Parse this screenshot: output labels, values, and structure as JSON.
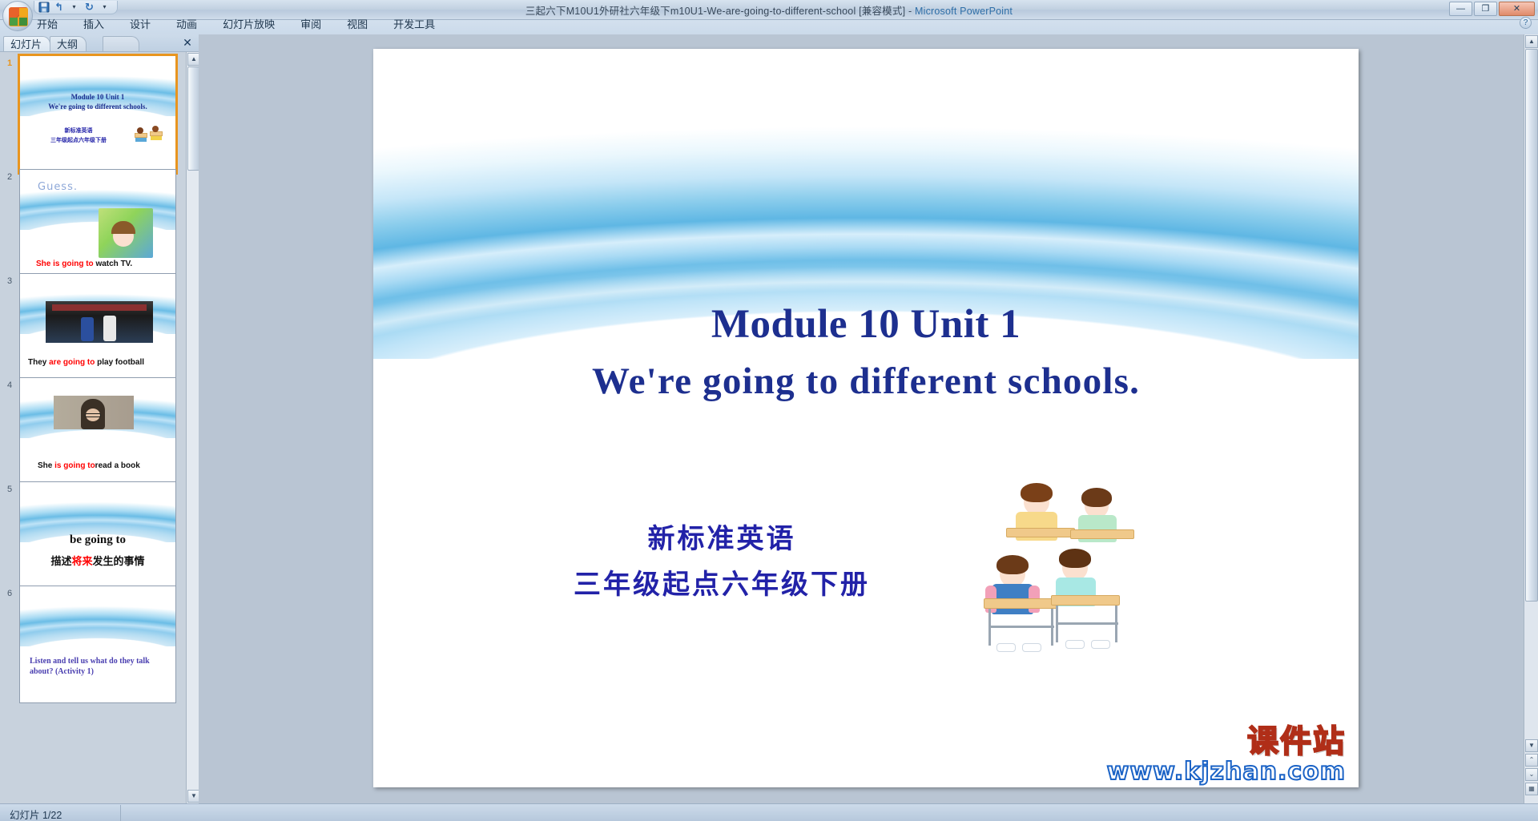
{
  "window": {
    "title": "三起六下M10U1外研社六年级下m10U1-We-are-going-to-different-school [兼容模式]",
    "separator": "-",
    "app_name": "Microsoft PowerPoint",
    "minimize": "—",
    "maximize": "❐",
    "close": "✕",
    "help_icon": "?"
  },
  "quick_access": {
    "save_icon": "save-icon",
    "undo_icon": "undo-icon",
    "undo_arrow": "↰",
    "undo_dropdown": "▾",
    "redo_arrow": "↻",
    "customize": "▾"
  },
  "ribbon_tabs": [
    {
      "label": "开始"
    },
    {
      "label": "插入"
    },
    {
      "label": "设计"
    },
    {
      "label": "动画"
    },
    {
      "label": "幻灯片放映"
    },
    {
      "label": "审阅"
    },
    {
      "label": "视图"
    },
    {
      "label": "开发工具"
    }
  ],
  "left_pane": {
    "tabs": [
      {
        "label": "幻灯片"
      },
      {
        "label": "大纲"
      }
    ],
    "close_label": "✕",
    "slides": [
      {
        "number": "1",
        "selected": true,
        "lines": [
          {
            "text": "Module 10 Unit 1"
          },
          {
            "text": "We're going to different schools."
          }
        ],
        "cn_lines": [
          "新标准英语",
          "三年级起点六年级下册"
        ]
      },
      {
        "number": "2",
        "selected": false,
        "top_text": "Guess.",
        "caption_red": "She is going to ",
        "caption_black": "watch TV."
      },
      {
        "number": "3",
        "selected": false,
        "caption_black": "They ",
        "caption_red": "are going to ",
        "caption_black2": "play football"
      },
      {
        "number": "4",
        "selected": false,
        "caption_black": "She ",
        "caption_red": "is going to",
        "caption_black2": "read a book"
      },
      {
        "number": "5",
        "selected": false,
        "line1": "be going to",
        "line2_a": "描述",
        "line2_red": "将来",
        "line2_b": "发生的事情"
      },
      {
        "number": "6",
        "selected": false,
        "caption": "Listen and tell us what do they talk about? (Activity 1)"
      }
    ]
  },
  "slide": {
    "title": "Module 10 Unit 1",
    "subtitle": "We're going to different schools.",
    "cn_line1": "新标准英语",
    "cn_line2": "三年级起点六年级下册",
    "watermark_cn": "课件站",
    "watermark_en": "www.kjzhan.com"
  },
  "status": {
    "slide_counter": "幻灯片 1/22"
  },
  "scroll": {
    "up_arrow": "▲",
    "down_arrow": "▼",
    "prev_slide": "⌃",
    "next_slide": "⌄"
  },
  "colors": {
    "title_blue": "#1d2f8f",
    "cn_blue": "#2222a8",
    "accent_orange": "#e8951f",
    "red": "#ff0000",
    "app_title_blue": "#2f6fa8"
  }
}
